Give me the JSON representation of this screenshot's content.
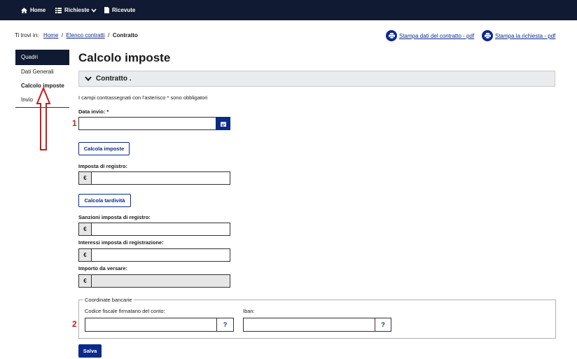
{
  "nav": {
    "home": "Home",
    "richieste": "Richieste",
    "ricevute": "Ricevute"
  },
  "breadcrumb": {
    "prefix": "Ti trovi in:",
    "home": "Home",
    "sep": "/",
    "elenco": "Elenco contratti",
    "current": "Contratto"
  },
  "print": {
    "contratto": "Stampa dati del contratto - pdf",
    "richiesta": "Stampa la richiesta - pdf"
  },
  "sidebar": {
    "header": "Quadri",
    "items": [
      {
        "label": "Dati Generali"
      },
      {
        "label": "Calcolo imposte"
      },
      {
        "label": "Invio"
      }
    ]
  },
  "page": {
    "title": "Calcolo imposte",
    "accordion": "Contratto .",
    "required_note": "I campi contrassegnati con l'asterisco * sono obbligatori"
  },
  "form": {
    "data_invio_label": "Data invio: *",
    "calcola_imposte": "Calcola imposte",
    "imposta_registro_label": "Imposta di registro:",
    "calcola_tardivita": "Calcola tardività",
    "sanzioni_label": "Sanzioni imposta di registro:",
    "interessi_label": "Interessi imposta di registrazione:",
    "importo_label": "Importo da versare:",
    "currency": "€",
    "coordinate_legend": "Coordinate bancarie",
    "codice_fiscale_label": "Codice fiscale firmatario del conto:",
    "iban_label": "Iban:",
    "help": "?",
    "salva": "Salva"
  },
  "annotations": {
    "one": "1",
    "two": "2"
  },
  "colors": {
    "nav_bg": "#101a33",
    "primary": "#0b2a8a",
    "annotation": "#d11a1a"
  }
}
